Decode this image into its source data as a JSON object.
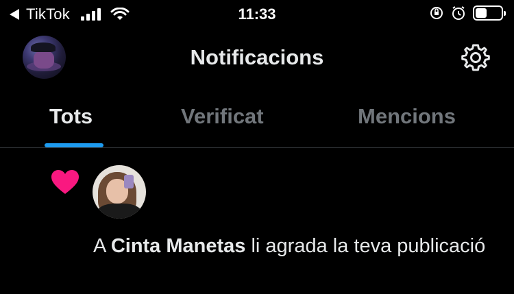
{
  "status_bar": {
    "back_app": "TikTok",
    "time": "11:33",
    "battery_level": 0.45
  },
  "header": {
    "title": "Notificacions"
  },
  "tabs": [
    {
      "label": "Tots",
      "active": true
    },
    {
      "label": "Verificat",
      "active": false
    },
    {
      "label": "Mencions",
      "active": false
    }
  ],
  "notification": {
    "icon": "heart-icon",
    "prefix": "A",
    "user_name": "Cinta Manetas",
    "action_text": "li agrada la teva publicació"
  },
  "colors": {
    "accent": "#1d9bf0",
    "heart": "#f91880",
    "text_primary": "#e7e9ea",
    "text_secondary": "#71767b",
    "background": "#000000"
  }
}
